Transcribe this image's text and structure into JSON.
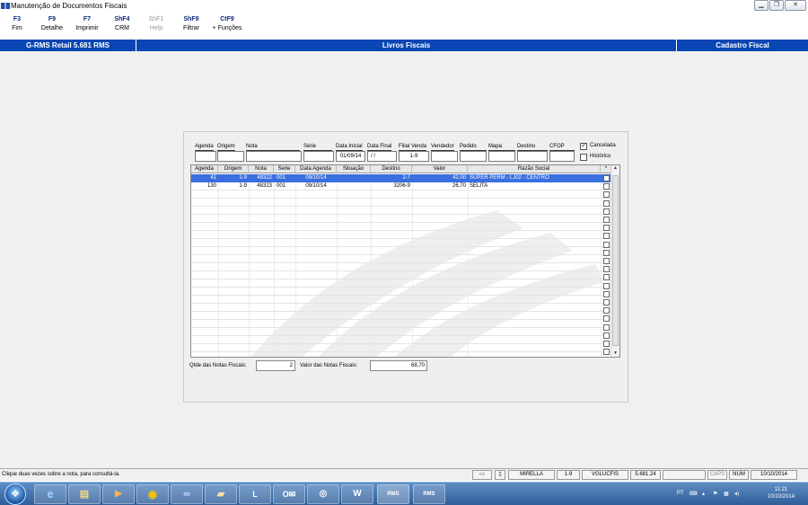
{
  "window": {
    "title": "Manutenção de Documentos Fiscais",
    "controls": [
      "minimize-icon",
      "restore-icon",
      "close-icon"
    ]
  },
  "function_keys": [
    {
      "key": "F3",
      "label": "Fim",
      "enabled": true
    },
    {
      "key": "F9",
      "label": "Detalhe",
      "enabled": true
    },
    {
      "key": "F7",
      "label": "Imprimir",
      "enabled": true
    },
    {
      "key": "ShF4",
      "label": "CRM",
      "enabled": true
    },
    {
      "key": "ShF1",
      "label": "Help",
      "enabled": false
    },
    {
      "key": "ShF9",
      "label": "Filtrar",
      "enabled": true
    },
    {
      "key": "CtF9",
      "label": "+ Funções",
      "enabled": true
    }
  ],
  "header": {
    "app": "G-RMS Retail 5.681 RMS",
    "module": "Livros Fiscais",
    "section": "Cadastro Fiscal"
  },
  "filters": {
    "agenda": {
      "label": "Agenda",
      "value": ""
    },
    "origem": {
      "label": "Origem",
      "value": ""
    },
    "nota": {
      "label": "Nota",
      "value": ""
    },
    "serie": {
      "label": "Série",
      "value": ""
    },
    "data_inicial": {
      "label": "Data Inicial",
      "value": "01/09/14"
    },
    "data_final": {
      "label": "Data Final",
      "value": " / /"
    },
    "filial_venda": {
      "label": "Filial Venda",
      "value": "1-9"
    },
    "vendedor": {
      "label": "Vendedor",
      "value": ""
    },
    "pedido": {
      "label": "Pedido",
      "value": ""
    },
    "mapa": {
      "label": "Mapa",
      "value": ""
    },
    "destino": {
      "label": "Destino",
      "value": ""
    },
    "cfop": {
      "label": "CFOP",
      "value": ""
    },
    "cancelada": {
      "label": "Cancelada",
      "checked": true
    },
    "historico": {
      "label": "Histórico",
      "checked": false
    }
  },
  "grid": {
    "columns": [
      "Agenda",
      "Origem",
      "Nota",
      "Serie",
      "Data Agenda",
      "Situação",
      "Destino",
      "Valor",
      "Razão Social",
      "*"
    ],
    "rows": [
      {
        "agenda": "41",
        "origem": "1-9",
        "nota": "48322",
        "serie": "001",
        "data_agenda": "09/10/14",
        "situacao": "",
        "destino": "2-7",
        "valor": "42,00",
        "razao_social": "SUPER PERM - LJ02 - CENTRO",
        "selected": true
      },
      {
        "agenda": "130",
        "origem": "1-9",
        "nota": "48323",
        "serie": "001",
        "data_agenda": "09/10/14",
        "situacao": "",
        "destino": "3206-9",
        "valor": "26,70",
        "razao_social": "SELITA",
        "selected": false
      }
    ]
  },
  "totals": {
    "qtde_label": "Qtde das Notas Fiscais:",
    "qtde_value": "2",
    "valor_label": "Valor  das Notas Fiscais:",
    "valor_value": "68,70"
  },
  "statusbar": {
    "message": "Clique duas vezes sobre a nota, para consultá-la.",
    "user": "MIRELLA",
    "filial": "1-9",
    "program": "VGLUCFIS",
    "version": "5.681.24",
    "caps": "CAPS",
    "num": "NUM",
    "date": "10/10/2014"
  },
  "taskbar": {
    "apps": [
      "ie-icon",
      "explorer-icon",
      "media-player-icon",
      "chrome-icon",
      "app-icon",
      "folder-icon",
      "lync-icon",
      "outlook-icon",
      "app-icon-2",
      "word-icon"
    ],
    "rms1": "RMS",
    "rms2": "RMS",
    "lang": "PT",
    "time": "11:21",
    "date": "10/10/2014"
  }
}
